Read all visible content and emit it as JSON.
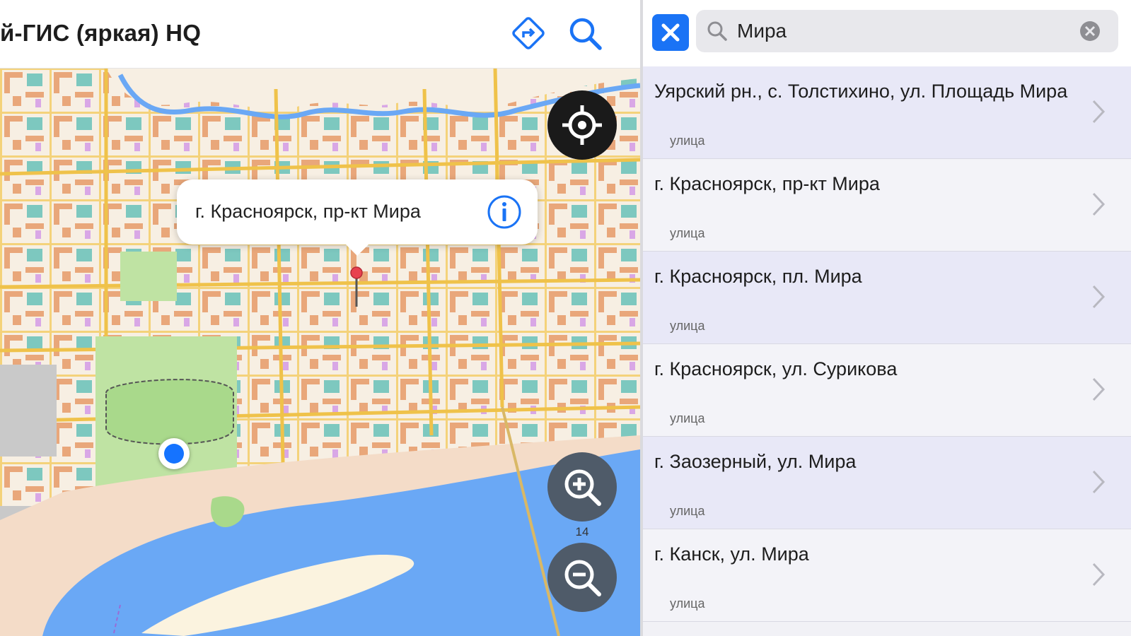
{
  "header": {
    "title": "й-ГИС (яркая) HQ",
    "route_icon": "route-diamond-icon",
    "search_icon": "search-icon"
  },
  "map": {
    "callout_text": "г. Красноярск, пр-кт Мира",
    "zoom_level": "14",
    "colors": {
      "water": "#6aa8f5",
      "park": "#bfe3a3",
      "land": "#f7efe3",
      "building": "#e9a77a",
      "road": "#f2c94c"
    }
  },
  "search": {
    "query": "Мира",
    "placeholder": ""
  },
  "results": [
    {
      "title": "Уярский рн., с. Толстихино, ул. Площадь Мира",
      "subtitle": "улица"
    },
    {
      "title": "г. Красноярск, пр-кт Мира",
      "subtitle": "улица"
    },
    {
      "title": "г. Красноярск, пл. Мира",
      "subtitle": "улица"
    },
    {
      "title": "г. Красноярск, ул. Сурикова",
      "subtitle": "улица"
    },
    {
      "title": "г. Заозерный, ул. Мира",
      "subtitle": "улица"
    },
    {
      "title": "г. Канск, ул. Мира",
      "subtitle": "улица"
    }
  ]
}
